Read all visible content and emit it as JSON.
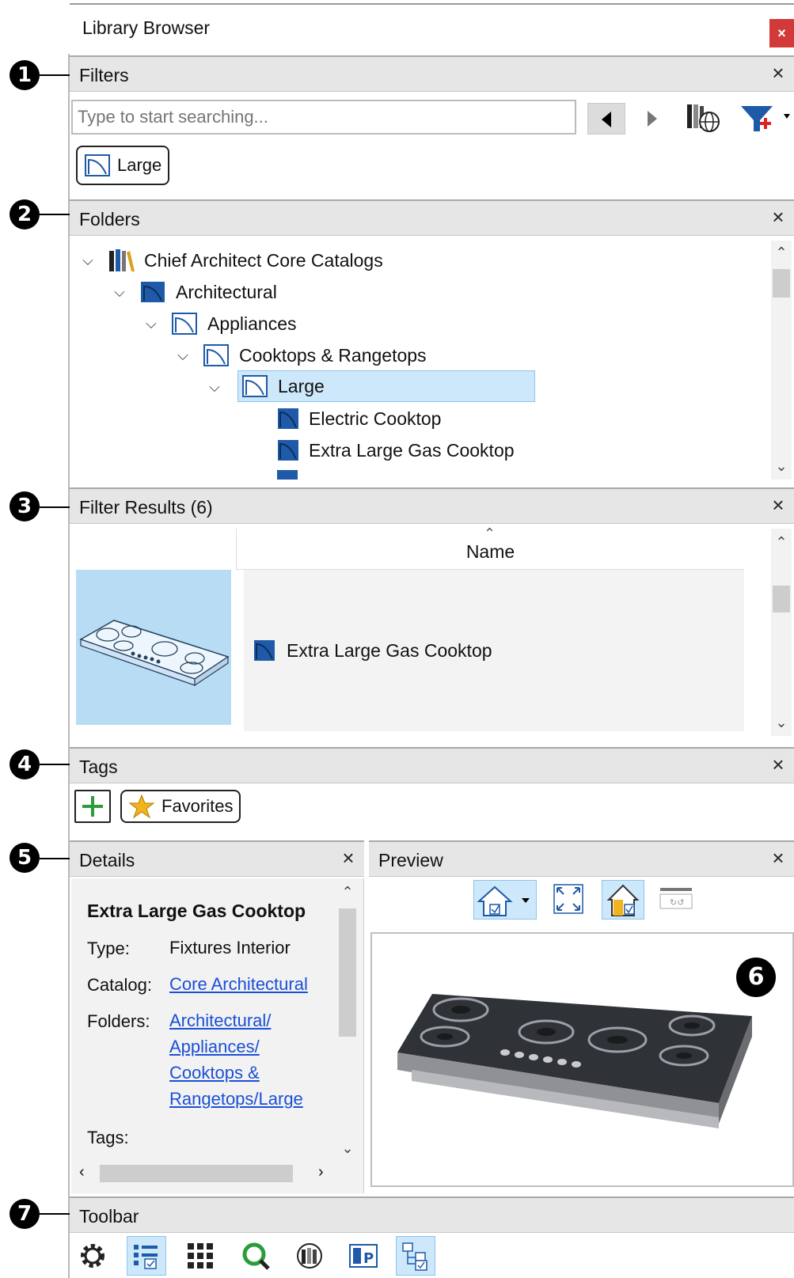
{
  "window": {
    "title": "Library Browser",
    "close_glyph": "×"
  },
  "callouts": [
    "1",
    "2",
    "3",
    "4",
    "5",
    "6",
    "7"
  ],
  "filters": {
    "title": "Filters",
    "search": {
      "placeholder": "Type to start searching...",
      "value": ""
    },
    "active_chip": "Large",
    "icons": [
      "back-arrow-icon",
      "forward-arrow-icon",
      "catalog-web-icon",
      "add-filter-icon"
    ]
  },
  "folders": {
    "title": "Folders",
    "tree": [
      {
        "label": "Chief Architect Core Catalogs",
        "icon": "catalogs-icon",
        "expanded": true
      },
      {
        "label": "Architectural",
        "icon": "folder-filled-icon",
        "expanded": true
      },
      {
        "label": "Appliances",
        "icon": "folder-outline-icon",
        "expanded": true
      },
      {
        "label": "Cooktops & Rangetops",
        "icon": "folder-outline-icon",
        "expanded": true
      },
      {
        "label": "Large",
        "icon": "folder-outline-icon",
        "expanded": true,
        "selected": true
      },
      {
        "label": "Electric Cooktop",
        "icon": "item-icon"
      },
      {
        "label": "Extra Large Gas Cooktop",
        "icon": "item-icon"
      }
    ]
  },
  "filter_results": {
    "title": "Filter Results (6)",
    "column_header": "Name",
    "rows": [
      {
        "name": "Extra Large Gas Cooktop"
      }
    ]
  },
  "tags": {
    "title": "Tags",
    "add_glyph": "+",
    "favorites_label": "Favorites"
  },
  "details": {
    "title": "Details",
    "item_name": "Extra Large Gas Cooktop",
    "type_label": "Type:",
    "type_value": "Fixtures Interior",
    "catalog_label": "Catalog:",
    "catalog_value": "Core Architectural",
    "folders_label": "Folders:",
    "folders_lines": [
      "Architectural/",
      "Appliances/",
      "Cooktops &",
      "Rangetops/Large"
    ],
    "tags_label": "Tags:"
  },
  "preview": {
    "title": "Preview",
    "tools": [
      "3d-view-icon",
      "fit-view-icon",
      "material-view-icon",
      "rotate-view-icon"
    ]
  },
  "toolbar": {
    "title": "Toolbar",
    "tools": [
      "settings-icon",
      "details-view-icon",
      "grid-view-icon",
      "search-catalog-icon",
      "library-web-icon",
      "preview-panel-icon",
      "folder-tree-icon"
    ]
  },
  "colors": {
    "selection": "#cde8fb",
    "link": "#1a4fd6",
    "header": "#e6e6e6",
    "accent_blue": "#1e5aa8"
  }
}
